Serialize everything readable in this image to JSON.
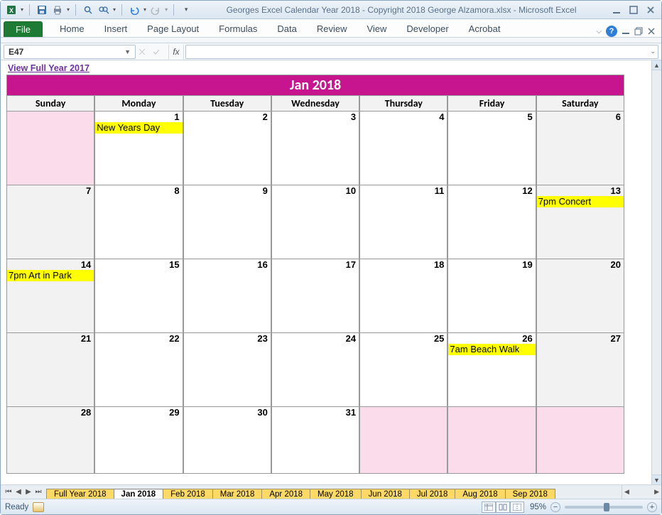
{
  "title_bar": {
    "app_title": "Georges Excel Calendar Year 2018 - Copyright 2018 George Alzamora.xlsx  -  Microsoft Excel"
  },
  "qat": {
    "excel_icon": "excel",
    "save": "save",
    "customize": "▾"
  },
  "ribbon": {
    "file": "File",
    "tabs": [
      "Home",
      "Insert",
      "Page Layout",
      "Formulas",
      "Data",
      "Review",
      "View",
      "Developer",
      "Acrobat"
    ]
  },
  "name_box": {
    "cell_ref": "E47",
    "fx_label": "fx"
  },
  "sheet": {
    "view_full_year_link": "View Full Year 2017",
    "month_title": "Jan 2018",
    "days_of_week": [
      "Sunday",
      "Monday",
      "Tuesday",
      "Wednesday",
      "Thursday",
      "Friday",
      "Saturday"
    ],
    "weeks": [
      {
        "cells": [
          {
            "num": "",
            "bg": "pink",
            "events": []
          },
          {
            "num": "1",
            "bg": "",
            "events": [
              "New Years Day"
            ]
          },
          {
            "num": "2",
            "bg": "",
            "events": []
          },
          {
            "num": "3",
            "bg": "",
            "events": []
          },
          {
            "num": "4",
            "bg": "",
            "events": []
          },
          {
            "num": "5",
            "bg": "",
            "events": []
          },
          {
            "num": "6",
            "bg": "gray",
            "events": []
          }
        ]
      },
      {
        "cells": [
          {
            "num": "7",
            "bg": "gray",
            "events": []
          },
          {
            "num": "8",
            "bg": "",
            "events": []
          },
          {
            "num": "9",
            "bg": "",
            "events": []
          },
          {
            "num": "10",
            "bg": "",
            "events": []
          },
          {
            "num": "11",
            "bg": "",
            "events": []
          },
          {
            "num": "12",
            "bg": "",
            "events": []
          },
          {
            "num": "13",
            "bg": "gray",
            "events": [
              "7pm Concert"
            ]
          }
        ]
      },
      {
        "cells": [
          {
            "num": "14",
            "bg": "gray",
            "events": [
              "7pm Art in Park"
            ]
          },
          {
            "num": "15",
            "bg": "",
            "events": []
          },
          {
            "num": "16",
            "bg": "",
            "events": []
          },
          {
            "num": "17",
            "bg": "",
            "events": []
          },
          {
            "num": "18",
            "bg": "",
            "events": []
          },
          {
            "num": "19",
            "bg": "",
            "events": []
          },
          {
            "num": "20",
            "bg": "gray",
            "events": []
          }
        ]
      },
      {
        "cells": [
          {
            "num": "21",
            "bg": "gray",
            "events": []
          },
          {
            "num": "22",
            "bg": "",
            "events": []
          },
          {
            "num": "23",
            "bg": "",
            "events": []
          },
          {
            "num": "24",
            "bg": "",
            "events": []
          },
          {
            "num": "25",
            "bg": "",
            "events": []
          },
          {
            "num": "26",
            "bg": "",
            "events": [
              "7am Beach Walk"
            ]
          },
          {
            "num": "27",
            "bg": "gray",
            "events": []
          }
        ]
      },
      {
        "cells": [
          {
            "num": "28",
            "bg": "gray",
            "events": []
          },
          {
            "num": "29",
            "bg": "",
            "events": []
          },
          {
            "num": "30",
            "bg": "",
            "events": []
          },
          {
            "num": "31",
            "bg": "",
            "events": []
          },
          {
            "num": "",
            "bg": "pink",
            "events": []
          },
          {
            "num": "",
            "bg": "pink",
            "events": []
          },
          {
            "num": "",
            "bg": "pink",
            "events": []
          }
        ]
      }
    ]
  },
  "sheet_tabs": {
    "tabs": [
      {
        "label": "Full Year 2018",
        "active": false
      },
      {
        "label": "Jan 2018",
        "active": true
      },
      {
        "label": "Feb 2018",
        "active": false
      },
      {
        "label": "Mar 2018",
        "active": false
      },
      {
        "label": "Apr 2018",
        "active": false
      },
      {
        "label": "May 2018",
        "active": false
      },
      {
        "label": "Jun 2018",
        "active": false
      },
      {
        "label": "Jul 2018",
        "active": false
      },
      {
        "label": "Aug 2018",
        "active": false
      },
      {
        "label": "Sep 2018",
        "active": false
      }
    ]
  },
  "status_bar": {
    "ready": "Ready",
    "zoom_pct": "95%",
    "minus": "−",
    "plus": "+"
  }
}
